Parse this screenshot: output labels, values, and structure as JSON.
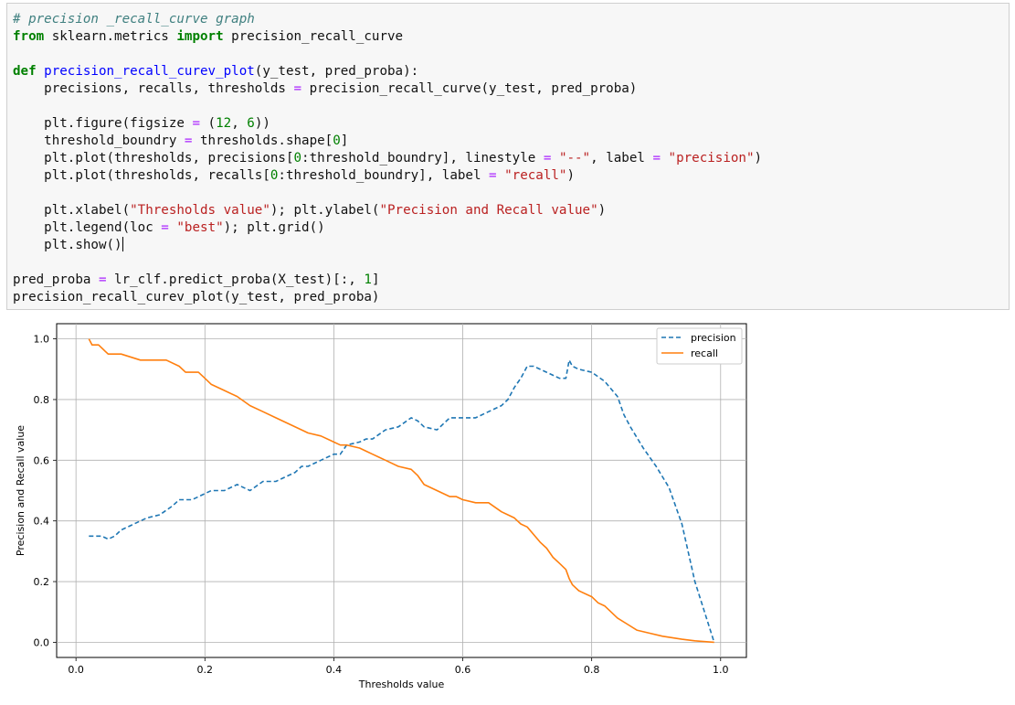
{
  "code_cell": {
    "lines": [
      [
        {
          "t": "cm",
          "s": "# precision _recall_curve graph"
        }
      ],
      [
        {
          "t": "kw",
          "s": "from"
        },
        {
          "t": "pl",
          "s": " sklearn.metrics "
        },
        {
          "t": "kw",
          "s": "import"
        },
        {
          "t": "pl",
          "s": " precision_recall_curve"
        }
      ],
      [],
      [
        {
          "t": "kw",
          "s": "def"
        },
        {
          "t": "pl",
          "s": " "
        },
        {
          "t": "fn",
          "s": "precision_recall_curev_plot"
        },
        {
          "t": "pl",
          "s": "(y_test, pred_proba):"
        }
      ],
      [
        {
          "t": "pl",
          "s": "    precisions, recalls, thresholds "
        },
        {
          "t": "op",
          "s": "="
        },
        {
          "t": "pl",
          "s": " precision_recall_curve(y_test, pred_proba)"
        }
      ],
      [],
      [
        {
          "t": "pl",
          "s": "    plt.figure(figsize "
        },
        {
          "t": "op",
          "s": "="
        },
        {
          "t": "pl",
          "s": " ("
        },
        {
          "t": "num",
          "s": "12"
        },
        {
          "t": "pl",
          "s": ", "
        },
        {
          "t": "num",
          "s": "6"
        },
        {
          "t": "pl",
          "s": "))"
        }
      ],
      [
        {
          "t": "pl",
          "s": "    threshold_boundry "
        },
        {
          "t": "op",
          "s": "="
        },
        {
          "t": "pl",
          "s": " thresholds.shape["
        },
        {
          "t": "num",
          "s": "0"
        },
        {
          "t": "pl",
          "s": "]"
        }
      ],
      [
        {
          "t": "pl",
          "s": "    plt.plot(thresholds, precisions["
        },
        {
          "t": "num",
          "s": "0"
        },
        {
          "t": "pl",
          "s": ":threshold_boundry], linestyle "
        },
        {
          "t": "op",
          "s": "="
        },
        {
          "t": "pl",
          "s": " "
        },
        {
          "t": "str",
          "s": "\"--\""
        },
        {
          "t": "pl",
          "s": ", label "
        },
        {
          "t": "op",
          "s": "="
        },
        {
          "t": "pl",
          "s": " "
        },
        {
          "t": "str",
          "s": "\"precision\""
        },
        {
          "t": "pl",
          "s": ")"
        }
      ],
      [
        {
          "t": "pl",
          "s": "    plt.plot(thresholds, recalls["
        },
        {
          "t": "num",
          "s": "0"
        },
        {
          "t": "pl",
          "s": ":threshold_boundry], label "
        },
        {
          "t": "op",
          "s": "="
        },
        {
          "t": "pl",
          "s": " "
        },
        {
          "t": "str",
          "s": "\"recall\""
        },
        {
          "t": "pl",
          "s": ")"
        }
      ],
      [],
      [
        {
          "t": "pl",
          "s": "    plt.xlabel("
        },
        {
          "t": "str",
          "s": "\"Thresholds value\""
        },
        {
          "t": "pl",
          "s": "); plt.ylabel("
        },
        {
          "t": "str",
          "s": "\"Precision and Recall value\""
        },
        {
          "t": "pl",
          "s": ")"
        }
      ],
      [
        {
          "t": "pl",
          "s": "    plt.legend(loc "
        },
        {
          "t": "op",
          "s": "="
        },
        {
          "t": "pl",
          "s": " "
        },
        {
          "t": "str",
          "s": "\"best\""
        },
        {
          "t": "pl",
          "s": "); plt.grid()"
        }
      ],
      [
        {
          "t": "pl",
          "s": "    plt.show()"
        }
      ],
      [],
      [
        {
          "t": "pl",
          "s": "pred_proba "
        },
        {
          "t": "op",
          "s": "="
        },
        {
          "t": "pl",
          "s": " lr_clf.predict_proba(X_test)[:, "
        },
        {
          "t": "num",
          "s": "1"
        },
        {
          "t": "pl",
          "s": "]"
        }
      ],
      [
        {
          "t": "pl",
          "s": "precision_recall_curev_plot(y_test, pred_proba)"
        }
      ]
    ]
  },
  "chart_data": {
    "type": "line",
    "title": "",
    "xlabel": "Thresholds value",
    "ylabel": "Precision and Recall value",
    "xlim": [
      -0.03,
      1.04
    ],
    "ylim": [
      -0.05,
      1.05
    ],
    "xticks": [
      0.0,
      0.2,
      0.4,
      0.6,
      0.8,
      1.0
    ],
    "xtick_labels": [
      "0.0",
      "0.2",
      "0.4",
      "0.6",
      "0.8",
      "1.0"
    ],
    "yticks": [
      0.0,
      0.2,
      0.4,
      0.6,
      0.8,
      1.0
    ],
    "ytick_labels": [
      "0.0",
      "0.2",
      "0.4",
      "0.6",
      "0.8",
      "1.0"
    ],
    "grid": true,
    "legend": "top-right",
    "series": [
      {
        "name": "precision",
        "linestyle": "dashed",
        "color": "#1f77b4",
        "x": [
          0.02,
          0.03,
          0.04,
          0.05,
          0.06,
          0.07,
          0.09,
          0.11,
          0.13,
          0.15,
          0.16,
          0.18,
          0.2,
          0.21,
          0.23,
          0.25,
          0.27,
          0.29,
          0.31,
          0.33,
          0.34,
          0.35,
          0.36,
          0.37,
          0.38,
          0.4,
          0.41,
          0.42,
          0.44,
          0.45,
          0.46,
          0.48,
          0.5,
          0.52,
          0.53,
          0.54,
          0.56,
          0.58,
          0.6,
          0.62,
          0.64,
          0.66,
          0.67,
          0.68,
          0.69,
          0.7,
          0.71,
          0.73,
          0.74,
          0.75,
          0.76,
          0.765,
          0.77,
          0.78,
          0.8,
          0.82,
          0.84,
          0.85,
          0.86,
          0.88,
          0.9,
          0.92,
          0.94,
          0.96,
          0.99
        ],
        "y": [
          0.35,
          0.35,
          0.35,
          0.34,
          0.35,
          0.37,
          0.39,
          0.41,
          0.42,
          0.45,
          0.47,
          0.47,
          0.49,
          0.5,
          0.5,
          0.52,
          0.5,
          0.53,
          0.53,
          0.55,
          0.56,
          0.58,
          0.58,
          0.59,
          0.6,
          0.62,
          0.62,
          0.65,
          0.66,
          0.67,
          0.67,
          0.7,
          0.71,
          0.74,
          0.73,
          0.71,
          0.7,
          0.74,
          0.74,
          0.74,
          0.76,
          0.78,
          0.8,
          0.84,
          0.87,
          0.91,
          0.91,
          0.89,
          0.88,
          0.87,
          0.87,
          0.93,
          0.91,
          0.9,
          0.89,
          0.86,
          0.81,
          0.75,
          0.71,
          0.64,
          0.58,
          0.51,
          0.39,
          0.2,
          0.0
        ]
      },
      {
        "name": "recall",
        "linestyle": "solid",
        "color": "#ff7f0e",
        "x": [
          0.02,
          0.025,
          0.035,
          0.045,
          0.05,
          0.07,
          0.1,
          0.12,
          0.14,
          0.16,
          0.17,
          0.19,
          0.2,
          0.21,
          0.23,
          0.25,
          0.27,
          0.29,
          0.31,
          0.33,
          0.35,
          0.36,
          0.38,
          0.4,
          0.41,
          0.42,
          0.44,
          0.45,
          0.46,
          0.47,
          0.48,
          0.5,
          0.52,
          0.53,
          0.54,
          0.56,
          0.58,
          0.59,
          0.6,
          0.62,
          0.64,
          0.66,
          0.67,
          0.68,
          0.69,
          0.7,
          0.72,
          0.73,
          0.74,
          0.75,
          0.76,
          0.765,
          0.77,
          0.78,
          0.8,
          0.81,
          0.82,
          0.83,
          0.84,
          0.855,
          0.87,
          0.89,
          0.91,
          0.94,
          0.96,
          0.99
        ],
        "y": [
          1.0,
          0.98,
          0.98,
          0.96,
          0.95,
          0.95,
          0.93,
          0.93,
          0.93,
          0.91,
          0.89,
          0.89,
          0.87,
          0.85,
          0.83,
          0.81,
          0.78,
          0.76,
          0.74,
          0.72,
          0.7,
          0.69,
          0.68,
          0.66,
          0.65,
          0.65,
          0.64,
          0.63,
          0.62,
          0.61,
          0.6,
          0.58,
          0.57,
          0.55,
          0.52,
          0.5,
          0.48,
          0.48,
          0.47,
          0.46,
          0.46,
          0.43,
          0.42,
          0.41,
          0.39,
          0.38,
          0.33,
          0.31,
          0.28,
          0.26,
          0.24,
          0.21,
          0.19,
          0.17,
          0.15,
          0.13,
          0.12,
          0.1,
          0.08,
          0.06,
          0.04,
          0.03,
          0.02,
          0.01,
          0.005,
          0.0
        ]
      }
    ]
  }
}
